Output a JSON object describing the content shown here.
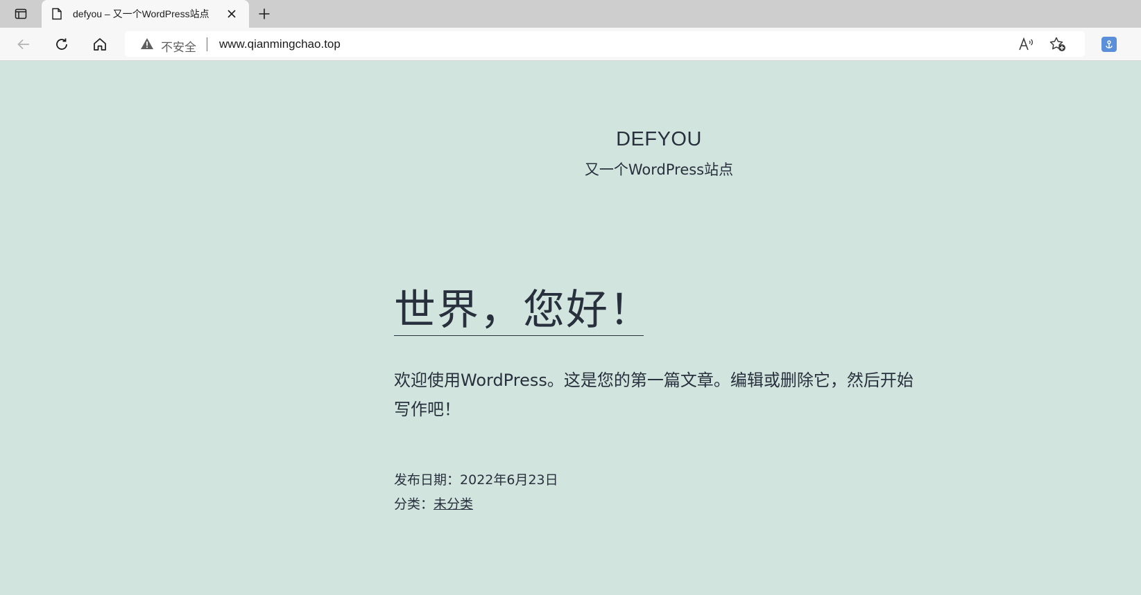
{
  "browser": {
    "tab": {
      "title": "defyou – 又一个WordPress站点",
      "close_label": "×",
      "new_tab_label": "+"
    },
    "address_bar": {
      "security_label": "不安全",
      "url": "www.qianmingchao.top"
    },
    "icons": [
      "tab-actions-icon",
      "page-icon",
      "close-icon",
      "plus-icon",
      "back-arrow-icon",
      "refresh-icon",
      "home-icon",
      "warning-icon",
      "read-aloud-icon",
      "add-favorite-icon",
      "extension-icon"
    ]
  },
  "site": {
    "title": "DEFYOU",
    "description": "又一个WordPress站点"
  },
  "post": {
    "title": "世界，您好！",
    "body": "欢迎使用WordPress。这是您的第一篇文章。编辑或删除它，然后开始写作吧！",
    "date_label": "发布日期：",
    "date": "2022年6月23日",
    "category_label": "分类：",
    "category": "未分类"
  },
  "colors": {
    "page_background": "#d1e4dd",
    "text": "#28303d",
    "tabstrip": "#cecece",
    "toolbar": "#f7f7f7"
  }
}
